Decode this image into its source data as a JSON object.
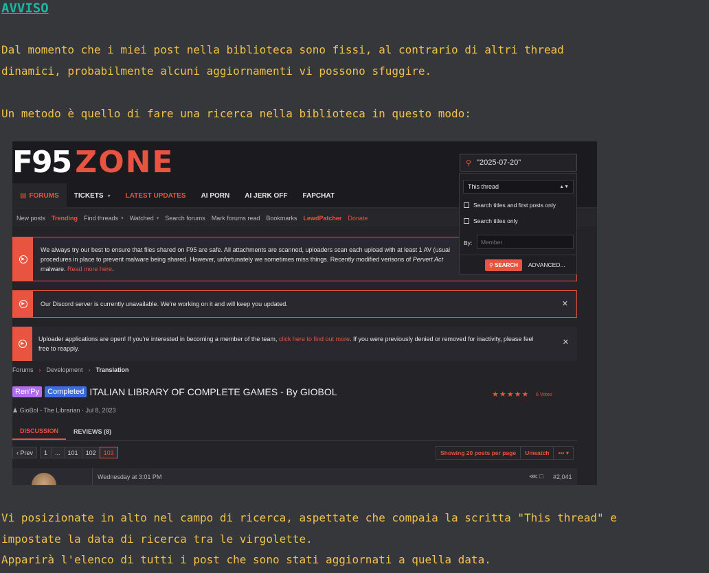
{
  "heading": "AVVISO",
  "paragraph1_line1": "Dal momento che i miei post nella biblioteca sono fissi, al contrario di altri thread",
  "paragraph1_line2": "dinamici, probabilmente alcuni aggiornamenti vi possono sfuggire.",
  "paragraph2": "Un metodo è quello di fare una ricerca nella biblioteca in questo modo:",
  "paragraph3_line1": "Vi posizionate in alto nel campo di ricerca, aspettate che compaia la scritta \"This thread\" e",
  "paragraph3_line2": "impostate la data di ricerca tra le virgolette.",
  "paragraph4": "Apparirà l'elenco di tutti i post che sono stati aggiornati a quella data.",
  "screenshot": {
    "logo_left": "F95",
    "logo_right": "ZONE",
    "search_value": "\"2025-07-20\"",
    "nav": {
      "forums": "FORUMS",
      "tickets": "TICKETS",
      "latest_updates": "LATEST UPDATES",
      "ai_porn": "AI PORN",
      "ai_jerk_off": "AI JERK OFF",
      "fapchat": "FAPCHAT"
    },
    "subnav": {
      "new_posts": "New posts",
      "trending": "Trending",
      "find_threads": "Find threads",
      "watched": "Watched",
      "search_forums": "Search forums",
      "mark_read": "Mark forums read",
      "bookmarks": "Bookmarks",
      "lewdpatcher": "LewdPatcher",
      "donate": "Donate"
    },
    "notice1_a": "We always try our best to ensure that files shared on F95 are safe. All attachments are scanned, uploaders scan each upload with at least 1 AV (usual",
    "notice1_b": "procedures in place to prevent malware being shared. However, unfortunately we sometimes miss things. Recently modified verisons of ",
    "notice1_c": "Pervert Act",
    "notice1_d": "malware. ",
    "notice1_link": "Read more here",
    "notice1_end": ".",
    "notice2": "Our Discord server is currently unavailable. We're working on it and will keep you updated.",
    "notice3_a": "Uploader applications are open! If you're interested in becoming a member of the team, ",
    "notice3_link": "click here to find out more",
    "notice3_b": ". If you were previously denied or removed for inactivity, please feel",
    "notice3_c": "free to reapply.",
    "dropdown": {
      "scope": "This thread",
      "opt1": "Search titles and first posts only",
      "opt2": "Search titles only",
      "by_label": "By:",
      "member_placeholder": "Member",
      "search_btn": "SEARCH",
      "advanced": "ADVANCED..."
    },
    "breadcrumbs": [
      "Forums",
      "Development",
      "Translation"
    ],
    "tag_renpy": "Ren'Py",
    "tag_completed": "Completed",
    "thread_title": "ITALIAN LIBRARY OF COMPLETE GAMES - By GIOBOL",
    "stars": "★★★★★",
    "votes": "6 Votes",
    "meta": "GioBol - The Librarian · Jul 8, 2023",
    "tab_discussion": "DISCUSSION",
    "tab_reviews": "REVIEWS (8)",
    "pager": [
      "‹ Prev",
      "1",
      "...",
      "101",
      "102",
      "103"
    ],
    "showing": "Showing 20 posts per page",
    "unwatch": "Unwatch",
    "more": "••• ▾",
    "post_date": "Wednesday at 3:01 PM",
    "post_num": "#2,041"
  }
}
